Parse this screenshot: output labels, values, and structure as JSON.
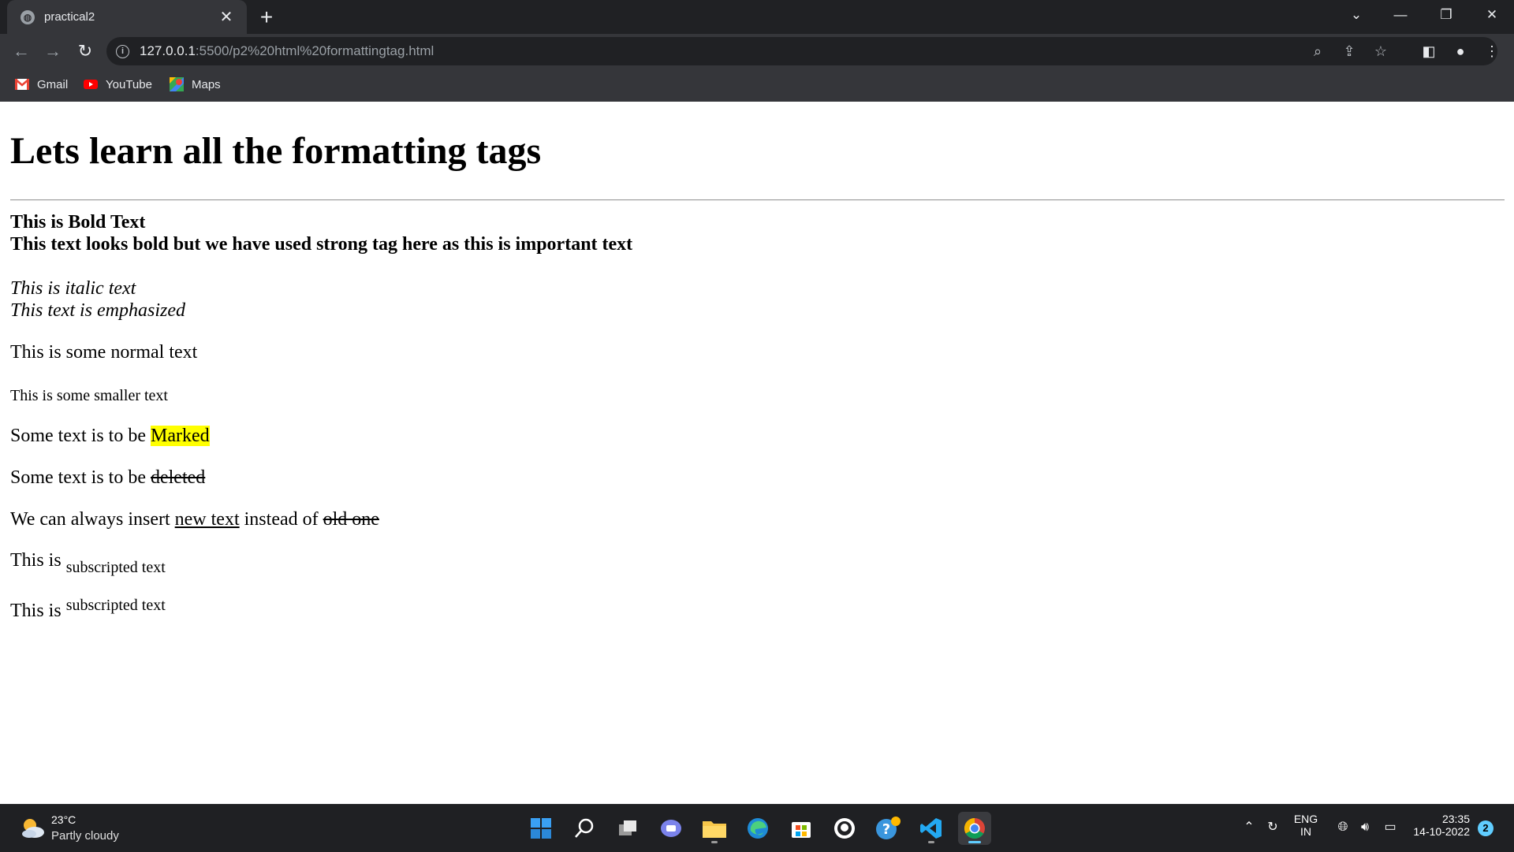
{
  "browser": {
    "tab": {
      "title": "practical2",
      "close_glyph": "✕"
    },
    "new_tab_glyph": "+",
    "address": {
      "host": "127.0.0.1",
      "rest": ":5500/p2%20html%20formattingtag.html"
    },
    "bookmarks": [
      {
        "label": "Gmail",
        "icon": "gmail-icon"
      },
      {
        "label": "YouTube",
        "icon": "youtube-icon"
      },
      {
        "label": "Maps",
        "icon": "maps-icon"
      }
    ]
  },
  "page": {
    "heading": "Lets learn all the formatting tags",
    "bold_text": "This is Bold Text",
    "strong_text": "This text looks bold but we have used strong tag here as this is important text",
    "italic_text": "This is italic text",
    "em_text": "This text is emphasized",
    "normal_text": "This is some normal text",
    "small_text": "This is some smaller text",
    "mark_line": {
      "prefix": "Some text is to be ",
      "marked": "Marked"
    },
    "del_line": {
      "prefix": "Some text is to be ",
      "deleted": "deleted"
    },
    "ins_line": {
      "prefix": "We can always insert ",
      "inserted": "new text",
      "middle": " instead of ",
      "old": "old one"
    },
    "sub_line": {
      "prefix": "This is ",
      "sub": "subscripted text"
    },
    "sup_line": {
      "prefix": "This is ",
      "sup": "subscripted text"
    }
  },
  "taskbar": {
    "weather": {
      "temp": "23°C",
      "desc": "Partly cloudy"
    },
    "apps": [
      "start",
      "search",
      "task-view",
      "chat",
      "file-explorer",
      "edge",
      "store",
      "github-desktop",
      "help",
      "vscode",
      "chrome"
    ],
    "active_app": "chrome",
    "tray": {
      "lang_line1": "ENG",
      "lang_line2": "IN",
      "time": "23:35",
      "date": "14-10-2022",
      "notifications": "2"
    }
  },
  "colors": {
    "mark": "#ffff00",
    "accent": "#60cdff",
    "chrome_dark": "#202124",
    "chrome_mid": "#35363a"
  }
}
